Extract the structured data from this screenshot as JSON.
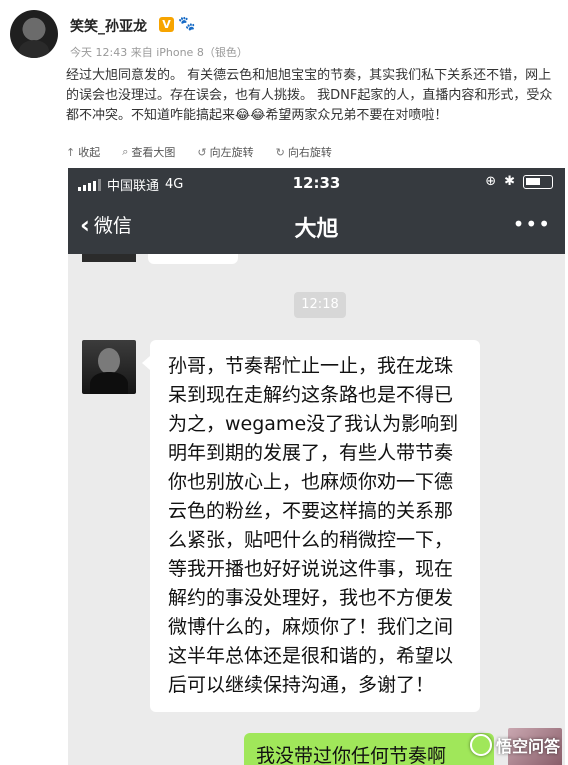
{
  "post": {
    "username": "笑笑_孙亚龙",
    "verified_badge": "V",
    "meta": "今天 12:43 来自 iPhone 8（银色）",
    "text": "经过大旭同意发的。 有关德云色和旭旭宝宝的节奏，其实我们私下关系还不错，网上的误会也没理过。存在误会，也有人挑拨。 我DNF起家的人，直播内容和形式，受众都不冲突。不知道咋能搞起来😂😂希望两家众兄弟不要在对喷啦！",
    "toolbar": {
      "collapse": "收起",
      "view_large": "查看大图",
      "rotate_left": "向左旋转",
      "rotate_right": "向右旋转"
    }
  },
  "phone": {
    "carrier": "中国联通",
    "network": "4G",
    "time": "12:33",
    "back_label": "微信",
    "chat_title": "大旭",
    "more": "•••",
    "timestamp": "12:18",
    "incoming_message": "孙哥，节奏帮忙止一止，我在龙珠呆到现在走解约这条路也是不得已为之，wegame没了我认为影响到明年到期的发展了，有些人带节奏你也别放心上，也麻烦你劝一下德云色的粉丝，不要这样搞的关系那么紧张，贴吧什么的稍微控一下，等我开播也好好说说这件事，现在解约的事没处理好，我也不方便发微博什么的，麻烦你了！我们之间这半年总体还是很和谐的，希望以后可以继续保持沟通，多谢了！",
    "outgoing_message": "我没带过你任何节奏啊"
  },
  "watermark": "悟空问答",
  "colors": {
    "wechat_header": "#363a3f",
    "chat_bg": "#ebebeb",
    "outgoing_bubble": "#a0e75a",
    "verified": "#f7a400"
  }
}
